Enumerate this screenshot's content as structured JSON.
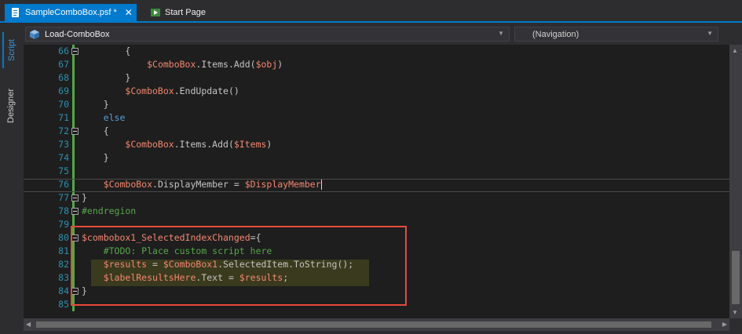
{
  "tabs": [
    {
      "label": "SampleComboBox.psf *",
      "close": "✕"
    },
    {
      "label": "Start Page"
    }
  ],
  "side_tabs": {
    "script": "Script",
    "designer": "Designer"
  },
  "navbar": {
    "function_selected": "Load-ComboBox",
    "navigation_selected": "(Navigation)"
  },
  "editor": {
    "lines": [
      {
        "n": "66",
        "code": [
          [
            "gl",
            "        {"
          ]
        ]
      },
      {
        "n": "67",
        "code": [
          [
            "gl",
            "            "
          ],
          [
            "var",
            "$ComboBox"
          ],
          [
            "gl",
            ".Items.Add("
          ],
          [
            "var",
            "$obj"
          ],
          [
            "gl",
            ")"
          ]
        ]
      },
      {
        "n": "68",
        "code": [
          [
            "gl",
            "        }"
          ]
        ]
      },
      {
        "n": "69",
        "code": [
          [
            "gl",
            "        "
          ],
          [
            "var",
            "$ComboBox"
          ],
          [
            "gl",
            ".EndUpdate()"
          ]
        ]
      },
      {
        "n": "70",
        "code": [
          [
            "gl",
            "    }"
          ]
        ]
      },
      {
        "n": "71",
        "code": [
          [
            "gl",
            "    "
          ],
          [
            "kw",
            "else"
          ]
        ]
      },
      {
        "n": "72",
        "code": [
          [
            "gl",
            "    {"
          ]
        ]
      },
      {
        "n": "73",
        "code": [
          [
            "gl",
            "        "
          ],
          [
            "var",
            "$ComboBox"
          ],
          [
            "gl",
            ".Items.Add("
          ],
          [
            "var",
            "$Items"
          ],
          [
            "gl",
            ")"
          ]
        ]
      },
      {
        "n": "74",
        "code": [
          [
            "gl",
            "    }"
          ]
        ]
      },
      {
        "n": "75",
        "code": [
          [
            "gl",
            ""
          ]
        ]
      },
      {
        "n": "76",
        "code": [
          [
            "gl",
            "    "
          ],
          [
            "var",
            "$ComboBox"
          ],
          [
            "gl",
            ".DisplayMember = "
          ],
          [
            "var",
            "$DisplayMember"
          ]
        ]
      },
      {
        "n": "77",
        "code": [
          [
            "gl",
            "}"
          ]
        ]
      },
      {
        "n": "78",
        "code": [
          [
            "cm",
            "#endregion"
          ]
        ]
      },
      {
        "n": "79",
        "code": [
          [
            "gl",
            ""
          ]
        ]
      },
      {
        "n": "80",
        "code": [
          [
            "var",
            "$combobox1_SelectedIndexChanged"
          ],
          [
            "gl",
            "={"
          ]
        ]
      },
      {
        "n": "81",
        "code": [
          [
            "gl",
            "    "
          ],
          [
            "cm",
            "#TODO: Place custom script here"
          ]
        ]
      },
      {
        "n": "82",
        "code": [
          [
            "gl",
            "    "
          ],
          [
            "var",
            "$results"
          ],
          [
            "gl",
            " = "
          ],
          [
            "var",
            "$ComboBox1"
          ],
          [
            "gl",
            ".SelectedItem.ToString();"
          ]
        ]
      },
      {
        "n": "83",
        "code": [
          [
            "gl",
            "    "
          ],
          [
            "var",
            "$labelResultsHere"
          ],
          [
            "gl",
            ".Text = "
          ],
          [
            "var",
            "$results"
          ],
          [
            "gl",
            ";"
          ]
        ]
      },
      {
        "n": "84",
        "code": [
          [
            "gl",
            "}"
          ]
        ]
      },
      {
        "n": "85",
        "code": [
          [
            "gl",
            ""
          ]
        ]
      }
    ],
    "colors": {
      "variable": "#f48771",
      "keyword": "#569cd6",
      "comment": "#57a64a",
      "line_number": "#2b91af",
      "annotation_box": "#e84a3c"
    }
  }
}
